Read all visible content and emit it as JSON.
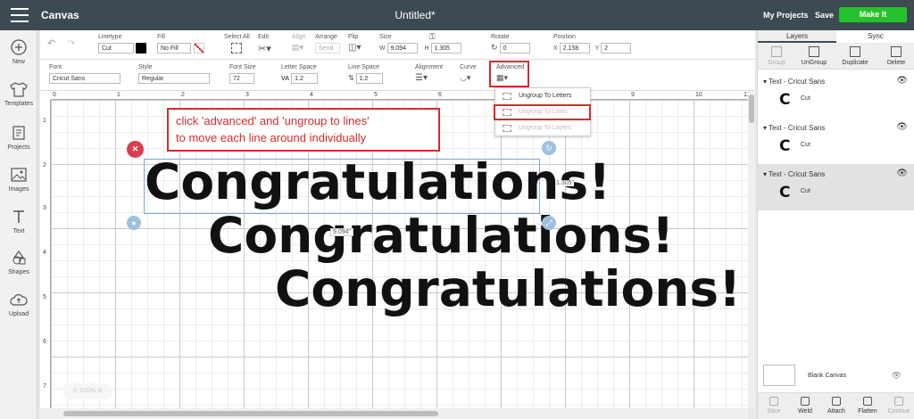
{
  "topbar": {
    "app_title": "Canvas",
    "doc_title": "Untitled*",
    "my_projects": "My Projects",
    "save": "Save",
    "make_it": "Make It"
  },
  "left_tools": [
    {
      "label": "New",
      "icon": "plus-circle-icon"
    },
    {
      "label": "Templates",
      "icon": "shirt-icon"
    },
    {
      "label": "Projects",
      "icon": "projects-icon"
    },
    {
      "label": "Images",
      "icon": "image-icon"
    },
    {
      "label": "Text",
      "icon": "text-t-icon"
    },
    {
      "label": "Shapes",
      "icon": "shapes-icon"
    },
    {
      "label": "Upload",
      "icon": "cloud-upload-icon"
    }
  ],
  "toolbar1": {
    "linetype_label": "Linetype",
    "linetype_value": "Cut",
    "fill_label": "Fill",
    "fill_value": "No Fill",
    "select_all": "Select All",
    "edit": "Edit",
    "align": "Align",
    "arrange": "Arrange",
    "arrange_value": "Send",
    "flip": "Flip",
    "size_label": "Size",
    "w_label": "W",
    "w_value": "9.094",
    "h_label": "H",
    "h_value": "1.305",
    "rotate_label": "Rotate",
    "rotate_value": "0",
    "position_label": "Position",
    "x_label": "X",
    "x_value": "2.158",
    "y_label": "Y",
    "y_value": "2"
  },
  "toolbar2": {
    "font_label": "Font",
    "font_value": "Cricut Sans",
    "style_label": "Style",
    "style_value": "Regular",
    "font_size_label": "Font Size",
    "font_size_value": "72",
    "letter_space_label": "Letter Space",
    "letter_space_value": "1.2",
    "line_space_label": "Line Space",
    "line_space_value": "1.2",
    "alignment_label": "Alignment",
    "curve_label": "Curve",
    "advanced_label": "Advanced"
  },
  "advanced_menu": [
    "Ungroup To Letters",
    "Ungroup To Lines",
    "Ungroup To Layers"
  ],
  "annotation": {
    "line1": "click 'advanced' and 'ungroup to lines'",
    "line2": "to move each line around individually"
  },
  "canvas": {
    "text_line": "Congratulations!",
    "width_tag": "9.094\"",
    "height_tag": "1.305\"",
    "zoom": "100%",
    "ruler_top": [
      "0",
      "1",
      "2",
      "3",
      "4",
      "5",
      "6",
      "7",
      "8",
      "9",
      "10",
      "11"
    ],
    "ruler_left": [
      "1",
      "2",
      "3",
      "4",
      "5",
      "6",
      "7"
    ]
  },
  "right_panel": {
    "tabs": [
      "Layers",
      "Sync"
    ],
    "actions": [
      "Group",
      "UnGroup",
      "Duplicate",
      "Delete"
    ],
    "layers": [
      {
        "name": "Text - Cricut Sans",
        "thumb": "C",
        "op": "Cut"
      },
      {
        "name": "Text - Cricut Sans",
        "thumb": "C",
        "op": "Cut"
      },
      {
        "name": "Text - Cricut Sans",
        "thumb": "C",
        "op": "Cut"
      }
    ],
    "blank_canvas": "Blank Canvas",
    "bottom_actions": [
      "Slice",
      "Weld",
      "Attach",
      "Flatten",
      "Contour"
    ]
  }
}
